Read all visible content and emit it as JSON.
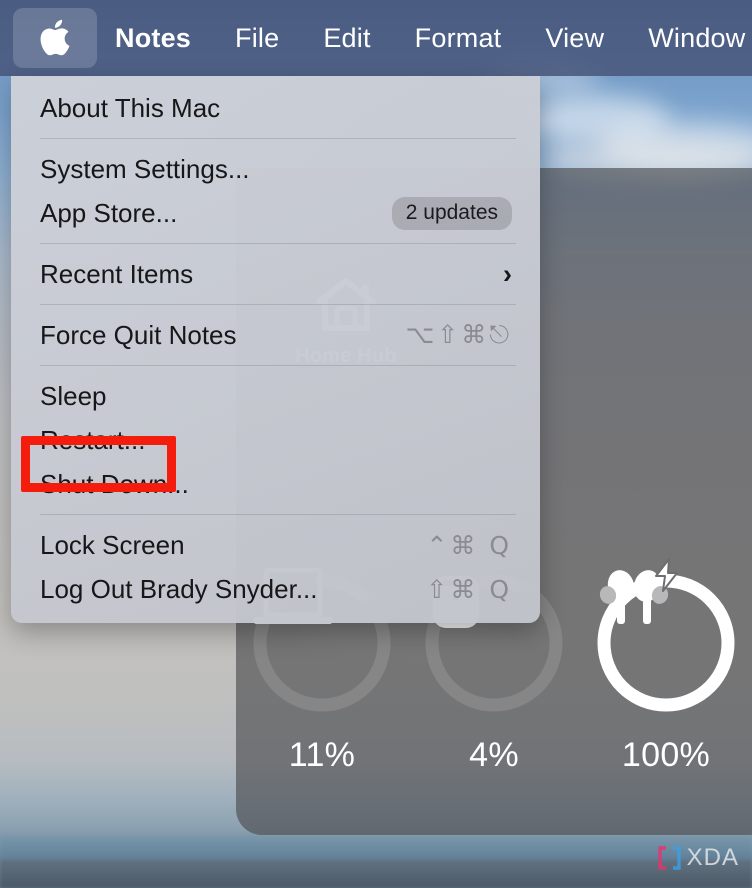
{
  "menubar": {
    "apple_icon": "apple-logo-icon",
    "items": [
      {
        "label": "Notes",
        "active": true
      },
      {
        "label": "File",
        "active": false
      },
      {
        "label": "Edit",
        "active": false
      },
      {
        "label": "Format",
        "active": false
      },
      {
        "label": "View",
        "active": false
      },
      {
        "label": "Window",
        "active": false
      }
    ]
  },
  "apple_menu": {
    "groups": [
      {
        "items": [
          {
            "label": "About This Mac",
            "accessory": "",
            "badge": "",
            "chevron": ""
          }
        ]
      },
      {
        "items": [
          {
            "label": "System Settings...",
            "accessory": "",
            "badge": "",
            "chevron": ""
          },
          {
            "label": "App Store...",
            "accessory": "",
            "badge": "2 updates",
            "chevron": ""
          }
        ]
      },
      {
        "items": [
          {
            "label": "Recent Items",
            "accessory": "",
            "badge": "",
            "chevron": "›"
          }
        ]
      },
      {
        "items": [
          {
            "label": "Force Quit Notes",
            "accessory": "⌥⇧⌘⎋",
            "badge": "",
            "chevron": ""
          }
        ]
      },
      {
        "items": [
          {
            "label": "Sleep",
            "accessory": "",
            "badge": "",
            "chevron": ""
          },
          {
            "label": "Restart...",
            "accessory": "",
            "badge": "",
            "chevron": "",
            "highlighted": true
          },
          {
            "label": "Shut Down...",
            "accessory": "",
            "badge": "",
            "chevron": ""
          }
        ]
      },
      {
        "items": [
          {
            "label": "Lock Screen",
            "accessory": "⌃⌘ Q",
            "badge": "",
            "chevron": ""
          },
          {
            "label": "Log Out Brady Snyder...",
            "accessory": "⇧⌘ Q",
            "badge": "",
            "chevron": ""
          }
        ]
      }
    ],
    "highlight_color": "#f41c0c",
    "highlighted_item": "Restart..."
  },
  "widget": {
    "home_hub": {
      "icon": "home-icon",
      "label": "Home Hub"
    },
    "devices": [
      {
        "name": "macbook-icon",
        "percent": "11%",
        "level": 11,
        "charging": false
      },
      {
        "name": "airpods-case-icon",
        "percent": "4%",
        "level": 4,
        "charging": false
      },
      {
        "name": "airpods-icon",
        "percent": "100%",
        "level": 100,
        "charging": true
      }
    ]
  },
  "watermark": {
    "text": "XDA",
    "bracket_left_color": "#e8336d",
    "bracket_right_color": "#3aa0e8"
  }
}
